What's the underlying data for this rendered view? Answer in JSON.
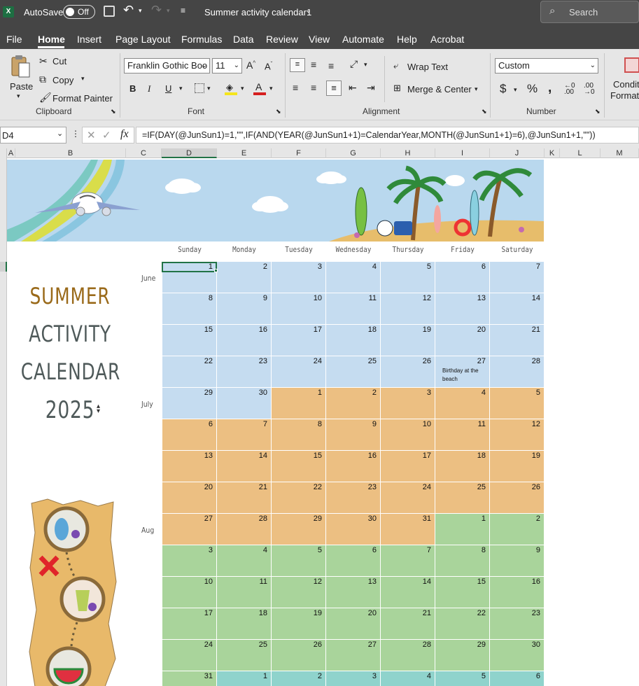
{
  "titlebar": {
    "app_icon": "excel-icon",
    "autosave_label": "AutoSave",
    "autosave_state": "Off",
    "filename": "Summer activity calendar1",
    "search_label": "Search"
  },
  "tabs": [
    "File",
    "Home",
    "Insert",
    "Page Layout",
    "Formulas",
    "Data",
    "Review",
    "View",
    "Automate",
    "Help",
    "Acrobat"
  ],
  "active_tab": "Home",
  "ribbon": {
    "clipboard": {
      "paste": "Paste",
      "cut": "Cut",
      "copy": "Copy",
      "format_painter": "Format Painter",
      "label": "Clipboard"
    },
    "font": {
      "family": "Franklin Gothic Boo",
      "size": "11",
      "label": "Font",
      "bold": "B",
      "italic": "I",
      "underline": "U"
    },
    "alignment": {
      "wrap_text": "Wrap Text",
      "merge_center": "Merge & Center",
      "label": "Alignment"
    },
    "number": {
      "format": "Custom",
      "label": "Number",
      "currency": "$",
      "percent": "%",
      "comma": ","
    },
    "styles": {
      "conditional_line1": "Condit",
      "conditional_line2": "Formatt"
    }
  },
  "formula_bar": {
    "name_box": "D4",
    "formula": "=IF(DAY(@JunSun1)=1,\"\",IF(AND(YEAR(@JunSun1+1)=CalendarYear,MONTH(@JunSun1+1)=6),@JunSun1+1,\"\"))"
  },
  "columns": [
    "A",
    "B",
    "C",
    "D",
    "E",
    "F",
    "G",
    "H",
    "I",
    "J",
    "K",
    "L",
    "M"
  ],
  "calendar": {
    "title_lines": [
      "SUMMER",
      "ACTIVITY",
      "CALENDAR"
    ],
    "year": "2025",
    "weekdays": [
      "Sunday",
      "Monday",
      "Tuesday",
      "Wednesday",
      "Thursday",
      "Friday",
      "Saturday"
    ],
    "month_labels": [
      {
        "name": "June",
        "row": 0
      },
      {
        "name": "July",
        "row": 4
      },
      {
        "name": "Aug",
        "row": 8
      }
    ],
    "colors": {
      "June": "#c5dcf0",
      "July": "#ecbf82",
      "Aug": "#a9d49b",
      "Sep": "#8fd3cc"
    },
    "rows": [
      [
        [
          1,
          "June"
        ],
        [
          2,
          "June"
        ],
        [
          3,
          "June"
        ],
        [
          4,
          "June"
        ],
        [
          5,
          "June"
        ],
        [
          6,
          "June"
        ],
        [
          7,
          "June"
        ]
      ],
      [
        [
          8,
          "June"
        ],
        [
          9,
          "June"
        ],
        [
          10,
          "June"
        ],
        [
          11,
          "June"
        ],
        [
          12,
          "June"
        ],
        [
          13,
          "June"
        ],
        [
          14,
          "June"
        ]
      ],
      [
        [
          15,
          "June"
        ],
        [
          16,
          "June"
        ],
        [
          17,
          "June"
        ],
        [
          18,
          "June"
        ],
        [
          19,
          "June"
        ],
        [
          20,
          "June"
        ],
        [
          21,
          "June"
        ]
      ],
      [
        [
          22,
          "June"
        ],
        [
          23,
          "June"
        ],
        [
          24,
          "June"
        ],
        [
          25,
          "June"
        ],
        [
          26,
          "June"
        ],
        [
          27,
          "June",
          "Birthday at the beach"
        ],
        [
          28,
          "June"
        ]
      ],
      [
        [
          29,
          "June"
        ],
        [
          30,
          "June"
        ],
        [
          1,
          "July"
        ],
        [
          2,
          "July"
        ],
        [
          3,
          "July"
        ],
        [
          4,
          "July"
        ],
        [
          5,
          "July"
        ]
      ],
      [
        [
          6,
          "July"
        ],
        [
          7,
          "July"
        ],
        [
          8,
          "July"
        ],
        [
          9,
          "July"
        ],
        [
          10,
          "July"
        ],
        [
          11,
          "July"
        ],
        [
          12,
          "July"
        ]
      ],
      [
        [
          13,
          "July"
        ],
        [
          14,
          "July"
        ],
        [
          15,
          "July"
        ],
        [
          16,
          "July"
        ],
        [
          17,
          "July"
        ],
        [
          18,
          "July"
        ],
        [
          19,
          "July"
        ]
      ],
      [
        [
          20,
          "July"
        ],
        [
          21,
          "July"
        ],
        [
          22,
          "July"
        ],
        [
          23,
          "July"
        ],
        [
          24,
          "July"
        ],
        [
          25,
          "July"
        ],
        [
          26,
          "July"
        ]
      ],
      [
        [
          27,
          "July"
        ],
        [
          28,
          "July"
        ],
        [
          29,
          "July"
        ],
        [
          30,
          "July"
        ],
        [
          31,
          "July"
        ],
        [
          1,
          "Aug"
        ],
        [
          2,
          "Aug"
        ]
      ],
      [
        [
          3,
          "Aug"
        ],
        [
          4,
          "Aug"
        ],
        [
          5,
          "Aug"
        ],
        [
          6,
          "Aug"
        ],
        [
          7,
          "Aug"
        ],
        [
          8,
          "Aug"
        ],
        [
          9,
          "Aug"
        ]
      ],
      [
        [
          10,
          "Aug"
        ],
        [
          11,
          "Aug"
        ],
        [
          12,
          "Aug"
        ],
        [
          13,
          "Aug"
        ],
        [
          14,
          "Aug"
        ],
        [
          15,
          "Aug"
        ],
        [
          16,
          "Aug"
        ]
      ],
      [
        [
          17,
          "Aug"
        ],
        [
          18,
          "Aug"
        ],
        [
          19,
          "Aug"
        ],
        [
          20,
          "Aug"
        ],
        [
          21,
          "Aug"
        ],
        [
          22,
          "Aug"
        ],
        [
          23,
          "Aug"
        ]
      ],
      [
        [
          24,
          "Aug"
        ],
        [
          25,
          "Aug"
        ],
        [
          26,
          "Aug"
        ],
        [
          27,
          "Aug"
        ],
        [
          28,
          "Aug"
        ],
        [
          29,
          "Aug"
        ],
        [
          30,
          "Aug"
        ]
      ],
      [
        [
          31,
          "Aug"
        ],
        [
          1,
          "Sep"
        ],
        [
          2,
          "Sep"
        ],
        [
          3,
          "Sep"
        ],
        [
          4,
          "Sep"
        ],
        [
          5,
          "Sep"
        ],
        [
          6,
          "Sep"
        ]
      ]
    ]
  }
}
